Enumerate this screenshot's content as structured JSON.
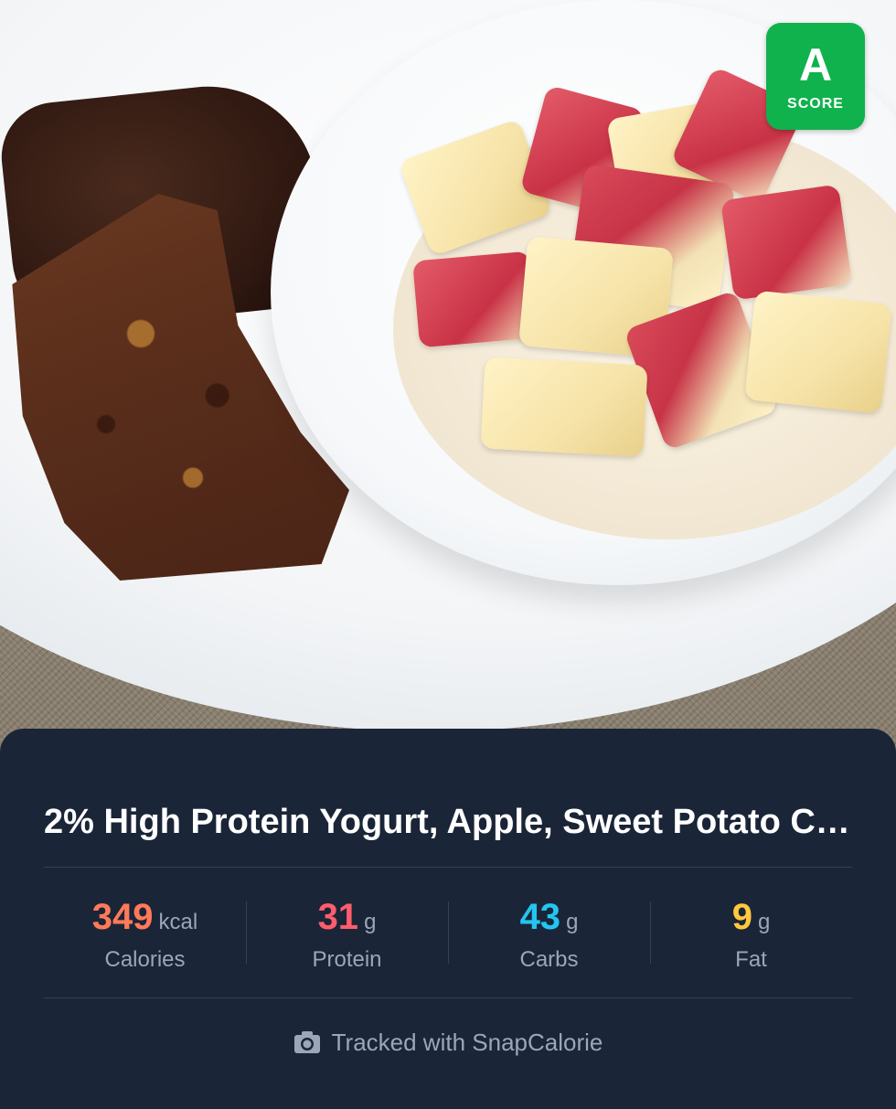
{
  "score": {
    "grade": "A",
    "label": "SCORE",
    "color": "#10b24d"
  },
  "meal": {
    "title": "2% High Protein Yogurt, Apple, Sweet Potato C…"
  },
  "nutrition": [
    {
      "value": "349",
      "unit": "kcal",
      "label": "Calories",
      "color": "#ff7a59"
    },
    {
      "value": "31",
      "unit": "g",
      "label": "Protein",
      "color": "#ff5d6c"
    },
    {
      "value": "43",
      "unit": "g",
      "label": "Carbs",
      "color": "#22c6f0"
    },
    {
      "value": "9",
      "unit": "g",
      "label": "Fat",
      "color": "#ffc83d"
    }
  ],
  "footer": {
    "icon": "camera-icon",
    "text": "Tracked with SnapCalorie"
  }
}
